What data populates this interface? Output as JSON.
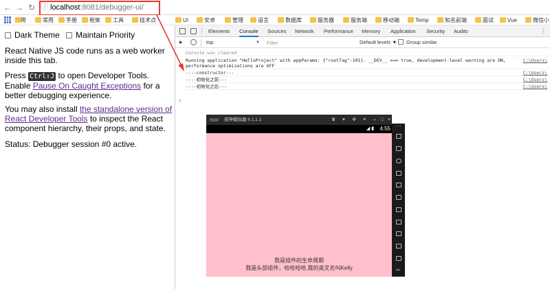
{
  "browser": {
    "url_host": "localhost",
    "url_rest": ":8081/debugger-ui/",
    "info_icon": "info-icon"
  },
  "bookmarks": [
    {
      "label": "应用"
    },
    {
      "label": "常用"
    },
    {
      "label": "手册"
    },
    {
      "label": "框架"
    },
    {
      "label": "工具"
    },
    {
      "label": "技术点"
    },
    {
      "label": "UI"
    },
    {
      "label": "安卓"
    },
    {
      "label": "管理"
    },
    {
      "label": "语言"
    },
    {
      "label": "数据库"
    },
    {
      "label": "服务器"
    },
    {
      "label": "服务端"
    },
    {
      "label": "移动端"
    },
    {
      "label": "Temp"
    },
    {
      "label": "知名前端"
    },
    {
      "label": "面试"
    },
    {
      "label": "Vue"
    },
    {
      "label": "微信小"
    }
  ],
  "page": {
    "dark_theme": "Dark Theme",
    "maintain_priority": "Maintain Priority",
    "p1": "React Native JS code runs as a web worker inside this tab.",
    "p2_a": "Press ",
    "p2_kbd": "Ctrl⇧J",
    "p2_b": " to open Developer Tools. Enable ",
    "p2_link": "Pause On Caught Exceptions",
    "p2_c": " for a better debugging experience.",
    "p3_a": "You may also install ",
    "p3_link": "the standalone version of React Developer Tools",
    "p3_b": " to inspect the React component hierarchy, their props, and state.",
    "p4": "Status: Debugger session #0 active."
  },
  "devtools": {
    "tabs": [
      "Elements",
      "Console",
      "Sources",
      "Network",
      "Performance",
      "Memory",
      "Application",
      "Security",
      "Audits"
    ],
    "active_tab": "Console",
    "context": "top",
    "filter_placeholder": "Filter",
    "levels": "Default levels ▼",
    "group_similar": "Group similar",
    "console": {
      "cleared": "Console was cleared",
      "running": "Running application \"HelloProject\" with appParams: {\"rootTag\":101}. __DEV__ === true, development-level warning are ON, performance optimizations are OFF",
      "constructor": "----constructor---",
      "before": "----初始化之前---",
      "after": "----初始化之后---",
      "source": "C:\\Users\\"
    }
  },
  "emulator": {
    "brand": "nox",
    "title": "夜神模拟器 6.1.1.1",
    "time": "4:55",
    "line1": "我是组件的生命周期",
    "line2": "我是头部组件，哈哈哈哈,我的英文名叫Kelly",
    "accent": "#ffc0cb"
  },
  "colors": {
    "highlight": "#e53935",
    "link": "#5b2a8a",
    "tab_active": "#1a73e8"
  }
}
